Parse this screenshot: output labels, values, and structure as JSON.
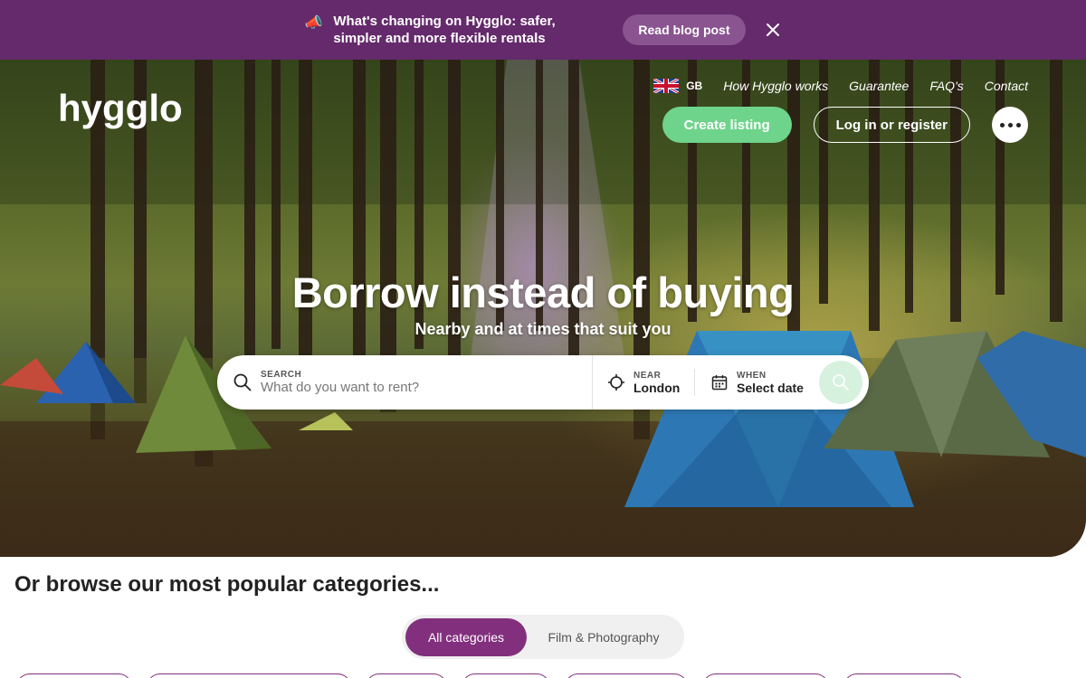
{
  "banner": {
    "megaphone_icon": "megaphone-icon",
    "text": "What's changing on Hygglo: safer, simpler and more flexible rentals",
    "button_label": "Read blog post",
    "close_icon": "close-icon",
    "background": "#642a6b"
  },
  "header": {
    "logo_text": "hygglo",
    "language": {
      "flag_icon": "uk-flag-icon",
      "code": "GB"
    },
    "nav": [
      "How Hygglo works",
      "Guarantee",
      "FAQ's",
      "Contact"
    ],
    "create_listing_label": "Create listing",
    "login_label": "Log in or register",
    "more_icon": "more-dots-icon",
    "accent": "#6fd48b"
  },
  "hero": {
    "headline": "Borrow instead of buying",
    "subline": "Nearby and at times that suit you"
  },
  "search": {
    "search_label": "SEARCH",
    "search_placeholder": "What do you want to rent?",
    "near_label": "NEAR",
    "near_value": "London",
    "when_label": "WHEN",
    "when_value": "Select date",
    "search_icon": "search-icon",
    "location_icon": "crosshair-icon",
    "calendar_icon": "calendar-icon"
  },
  "categories": {
    "title": "Or browse our most popular categories...",
    "tabs": [
      "All categories",
      "Film & Photography"
    ],
    "active_tab": "All categories",
    "brand": "#82307e"
  }
}
